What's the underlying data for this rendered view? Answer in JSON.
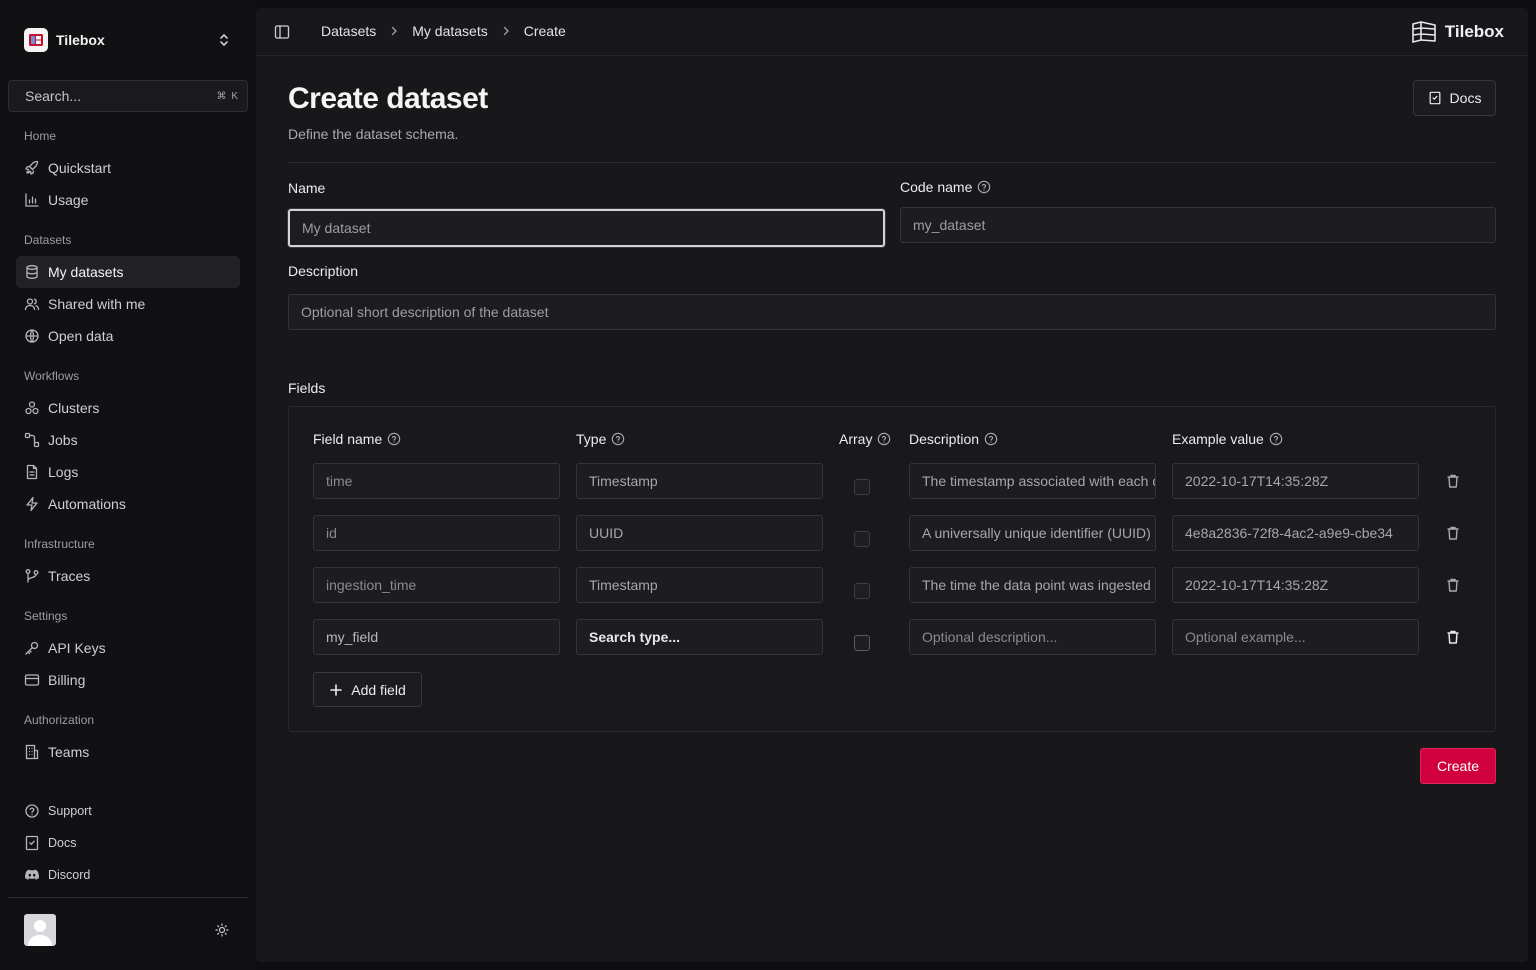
{
  "sidebar": {
    "org_name": "Tilebox",
    "search": {
      "placeholder": "Search...",
      "shortcut": "⌘ K"
    },
    "sections": {
      "home": "Home",
      "datasets": "Datasets",
      "workflows": "Workflows",
      "infrastructure": "Infrastructure",
      "settings": "Settings",
      "authorization": "Authorization"
    },
    "items": {
      "quickstart": "Quickstart",
      "usage": "Usage",
      "my_datasets": "My datasets",
      "shared_with_me": "Shared with me",
      "open_data": "Open data",
      "clusters": "Clusters",
      "jobs": "Jobs",
      "logs": "Logs",
      "automations": "Automations",
      "traces": "Traces",
      "api_keys": "API Keys",
      "billing": "Billing",
      "teams": "Teams",
      "support": "Support",
      "docs": "Docs",
      "discord": "Discord"
    }
  },
  "header": {
    "breadcrumb": [
      "Datasets",
      "My datasets",
      "Create"
    ],
    "brand": "Tilebox"
  },
  "page": {
    "title": "Create dataset",
    "subtitle": "Define the dataset schema.",
    "docs_button": "Docs"
  },
  "form": {
    "name_label": "Name",
    "name_placeholder": "My dataset",
    "code_name_label": "Code name",
    "code_name_placeholder": "my_dataset",
    "description_label": "Description",
    "description_placeholder": "Optional short description of the dataset",
    "fields_label": "Fields"
  },
  "fields_table": {
    "headers": {
      "field_name": "Field name",
      "type": "Type",
      "array": "Array",
      "description": "Description",
      "example_value": "Example value"
    },
    "rows": [
      {
        "name": "time",
        "type": "Timestamp",
        "description": "The timestamp associated with each data point",
        "example": "2022-10-17T14:35:28Z"
      },
      {
        "name": "id",
        "type": "UUID",
        "description": "A universally unique identifier (UUID)",
        "example": "4e8a2836-72f8-4ac2-a9e9-cbe34"
      },
      {
        "name": "ingestion_time",
        "type": "Timestamp",
        "description": "The time the data point was ingested",
        "example": "2022-10-17T14:35:28Z"
      },
      {
        "name": "my_field",
        "type": "Search type...",
        "description": "Optional description...",
        "example": "Optional example..."
      }
    ],
    "add_field": "Add field"
  },
  "actions": {
    "create": "Create"
  },
  "colors": {
    "accent": "#d1003f",
    "background": "#0e0e10",
    "panel": "#18181b"
  }
}
